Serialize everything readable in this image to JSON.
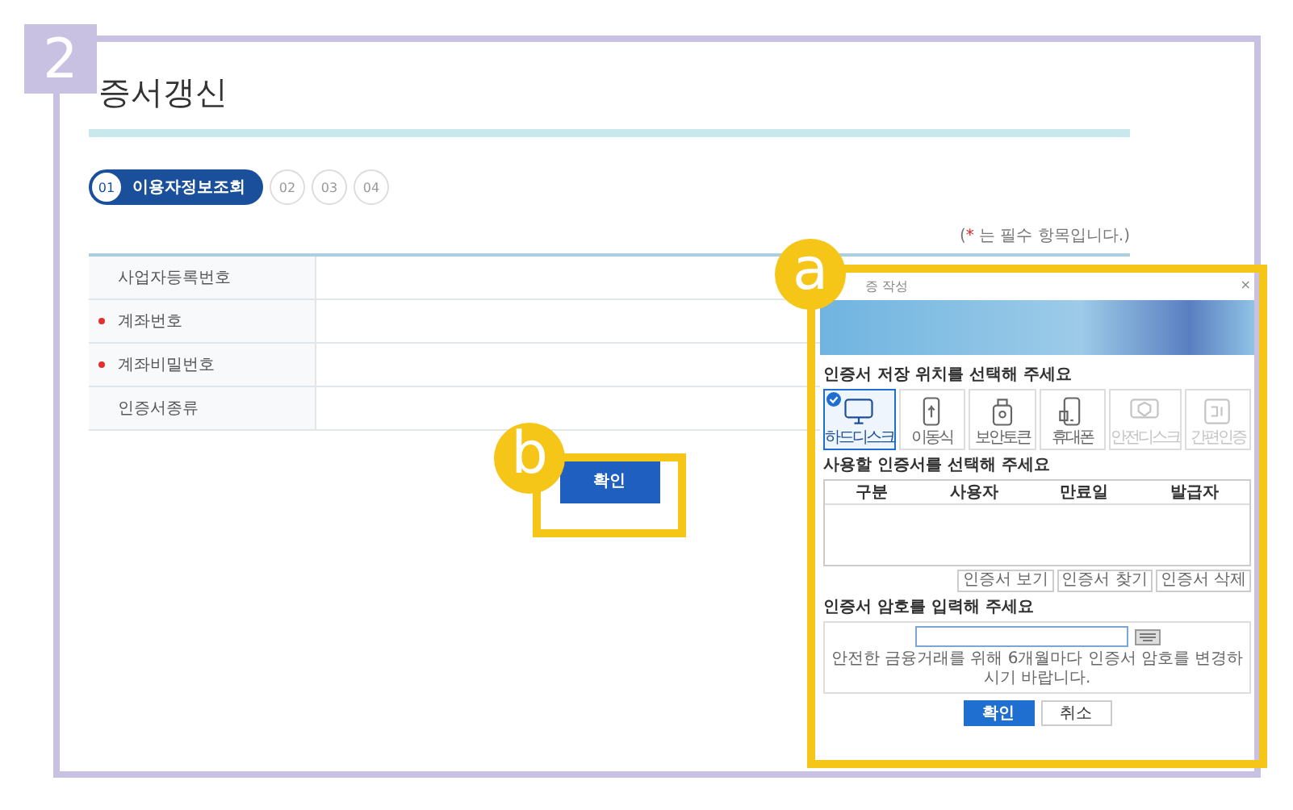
{
  "step_badge": "2",
  "page": {
    "title": "증서갱신",
    "steps": [
      {
        "number": "01",
        "label": "이용자정보조회",
        "selected": true
      },
      {
        "number": "02",
        "selected": false
      },
      {
        "number": "03",
        "selected": false
      },
      {
        "number": "04",
        "selected": false
      }
    ],
    "required_note": {
      "open": "(",
      "mark": "*",
      "rest": " 는 필수 항목입니다.)"
    },
    "form_rows": [
      {
        "label": "사업자등록번호",
        "required": false
      },
      {
        "label": "계좌번호",
        "required": true
      },
      {
        "label": "계좌비밀번호",
        "required": true
      },
      {
        "label": "인증서종류",
        "required": false
      }
    ],
    "confirm_button": "확인"
  },
  "annotations": [
    {
      "label": "a"
    },
    {
      "label": "b"
    }
  ],
  "certificate_dialog": {
    "title": "증 작성",
    "close": "×",
    "location_prompt": "인증서 저장 위치를 선택해 주세요",
    "locations": [
      {
        "kind": "hard-disk",
        "label": "하드디스크",
        "selected": true,
        "disabled": false
      },
      {
        "kind": "removable",
        "label": "이동식",
        "selected": false,
        "disabled": false
      },
      {
        "kind": "security-token",
        "label": "보안토큰",
        "selected": false,
        "disabled": false
      },
      {
        "kind": "phone",
        "label": "휴대폰",
        "selected": false,
        "disabled": false
      },
      {
        "kind": "safe-disk",
        "label": "안전디스크",
        "selected": false,
        "disabled": true
      },
      {
        "kind": "simple-auth",
        "label": "간편인증",
        "selected": false,
        "disabled": true
      }
    ],
    "certificate_prompt": "사용할 인증서를 선택해 주세요",
    "columns": [
      "구분",
      "사용자",
      "만료일",
      "발급자"
    ],
    "actions": [
      "인증서 보기",
      "인증서 찾기",
      "인증서 삭제"
    ],
    "password_prompt": "인증서 암호를 입력해 주세요",
    "password_note": "안전한 금융거래를 위해 6개월마다 인증서 암호를 변경하시기 바랍니다.",
    "buttons": [
      {
        "label": "확인",
        "kind": "primary"
      },
      {
        "label": "취소",
        "kind": "secondary"
      }
    ]
  }
}
